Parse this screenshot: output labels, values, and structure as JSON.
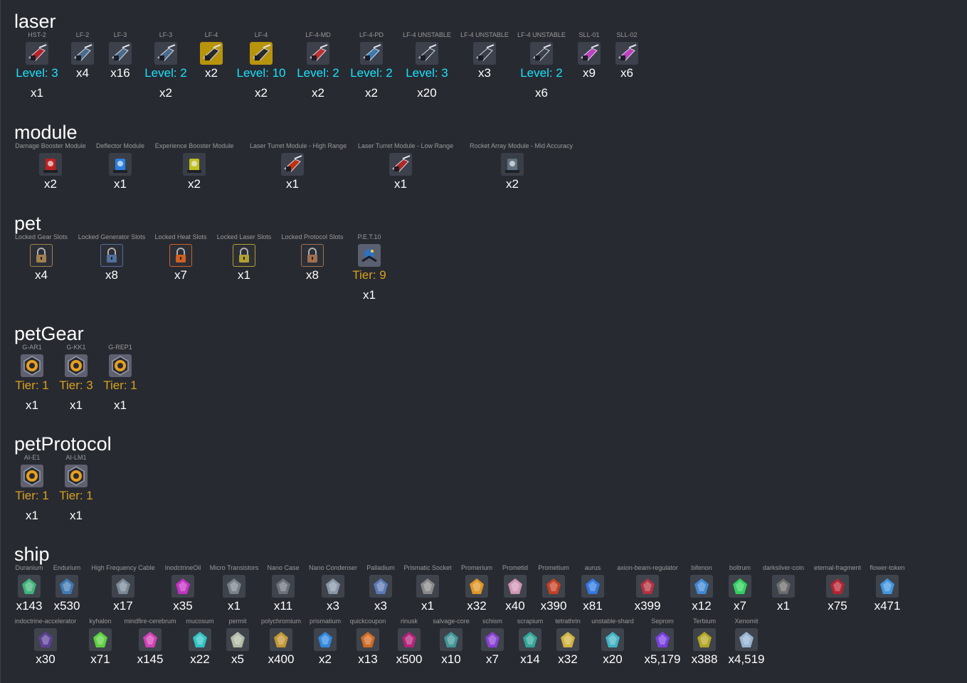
{
  "sections": [
    {
      "title": "laser",
      "items": [
        {
          "name": "HST-2",
          "stat": "Level: 3",
          "qty": "x1",
          "icon": "red-cannon-icon",
          "color": "#b8202a"
        },
        {
          "name": "LF-2",
          "qty": "x4",
          "icon": "laser-gun-icon",
          "color": "#4a6a8a"
        },
        {
          "name": "LF-3",
          "qty": "x16",
          "icon": "laser-gun-icon",
          "color": "#4a6a8a"
        },
        {
          "name": "LF-3",
          "stat": "Level: 2",
          "qty": "x2",
          "icon": "laser-gun-icon",
          "color": "#4a6a8a"
        },
        {
          "name": "LF-4",
          "qty": "x2",
          "icon": "gold-laser-icon",
          "color": "#c8a010"
        },
        {
          "name": "LF-4",
          "stat": "Level: 10",
          "qty": "x2",
          "icon": "gold-laser-icon",
          "color": "#c8a010"
        },
        {
          "name": "LF-4-MD",
          "stat": "Level: 2",
          "qty": "x2",
          "icon": "red-laser-icon",
          "color": "#c03030"
        },
        {
          "name": "LF-4-PD",
          "stat": "Level: 2",
          "qty": "x2",
          "icon": "blue-laser-icon",
          "color": "#3a7ab0"
        },
        {
          "name": "LF-4 UNSTABLE",
          "stat": "Level: 3",
          "qty": "x20",
          "icon": "dark-laser-icon",
          "color": "#3a3f48"
        },
        {
          "name": "LF-4 UNSTABLE",
          "qty": "x3",
          "icon": "dark-laser-icon",
          "color": "#3a3f48"
        },
        {
          "name": "LF-4 UNSTABLE",
          "stat": "Level: 2",
          "qty": "x6",
          "icon": "dark-laser-icon",
          "color": "#3a3f48"
        },
        {
          "name": "SLL-01",
          "qty": "x9",
          "icon": "pink-laser-icon",
          "color": "#c040c0"
        },
        {
          "name": "SLL-02",
          "qty": "x6",
          "icon": "pink-laser-icon",
          "color": "#c040c0"
        }
      ]
    },
    {
      "title": "module",
      "items": [
        {
          "name": "Damage Booster Module",
          "qty": "x2",
          "icon": "damage-module-icon",
          "color": "#c02020"
        },
        {
          "name": "Deflector Module",
          "qty": "x1",
          "icon": "deflector-module-icon",
          "color": "#2a80e0"
        },
        {
          "name": "Experience Booster Module",
          "qty": "x2",
          "icon": "experience-module-icon",
          "color": "#c0c020"
        },
        {
          "name": "Laser Turret Module - High Range",
          "qty": "x1",
          "icon": "laser-turret-module-icon",
          "color": "#c03010"
        },
        {
          "name": "Laser Turret Module - Low Range",
          "qty": "x1",
          "icon": "laser-turret-module-icon",
          "color": "#b02828"
        },
        {
          "name": "Rocket Array Module - Mid Accuracy",
          "qty": "x2",
          "icon": "rocket-array-module-icon",
          "color": "#607080"
        }
      ]
    },
    {
      "title": "pet",
      "items": [
        {
          "name": "Locked Gear Slots",
          "qty": "x4",
          "icon": "padlock-icon",
          "color": "#a08050"
        },
        {
          "name": "Locked Generator Slots",
          "qty": "x8",
          "icon": "padlock-icon",
          "color": "#5070a0"
        },
        {
          "name": "Locked Heat Slots",
          "qty": "x7",
          "icon": "padlock-icon",
          "color": "#d06020"
        },
        {
          "name": "Locked Laser Slots",
          "qty": "x1",
          "icon": "padlock-icon",
          "color": "#b0a030"
        },
        {
          "name": "Locked Protocol Slots",
          "qty": "x8",
          "icon": "padlock-icon",
          "color": "#a07050"
        },
        {
          "name": "P.E.T.10",
          "stat": "Tier: 9",
          "qty": "x1",
          "icon": "pet-drone-icon",
          "color": "#3070c0"
        }
      ]
    },
    {
      "title": "petGear",
      "items": [
        {
          "name": "G-AR1",
          "stat": "Tier: 1",
          "qty": "x1",
          "icon": "gear-hex-icon",
          "color": "#e8a020"
        },
        {
          "name": "G-KK1",
          "stat": "Tier: 3",
          "qty": "x1",
          "icon": "gear-sun-icon",
          "color": "#e8a020"
        },
        {
          "name": "G-REP1",
          "stat": "Tier: 1",
          "qty": "x1",
          "icon": "gear-wrench-icon",
          "color": "#e8a020"
        }
      ]
    },
    {
      "title": "petProtocol",
      "items": [
        {
          "name": "AI-E1",
          "stat": "Tier: 1",
          "qty": "x1",
          "icon": "protocol-arrows-icon",
          "color": "#e8a020"
        },
        {
          "name": "AI-LM1",
          "stat": "Tier: 1",
          "qty": "x1",
          "icon": "protocol-star-icon",
          "color": "#e8a020"
        }
      ]
    },
    {
      "title": "ship",
      "items": [
        {
          "name": "Duranium",
          "qty": "x143",
          "icon": "green-crystal-icon",
          "color": "#40c080"
        },
        {
          "name": "Endurium",
          "qty": "x530",
          "icon": "blue-orb-icon",
          "color": "#4080c0"
        },
        {
          "name": "High Frequency Cable",
          "qty": "x17",
          "icon": "cable-icon",
          "color": "#8090a0"
        },
        {
          "name": "InodctrineOil",
          "qty": "x35",
          "icon": "magenta-vial-icon",
          "color": "#d030d0"
        },
        {
          "name": "Micro Transistors",
          "qty": "x1",
          "icon": "transistor-icon",
          "color": "#808890"
        },
        {
          "name": "Nano Case",
          "qty": "x11",
          "icon": "nano-case-icon",
          "color": "#707880"
        },
        {
          "name": "Nano Condenser",
          "qty": "x3",
          "icon": "condenser-icon",
          "color": "#90a0b0"
        },
        {
          "name": "Palladium",
          "qty": "x3",
          "icon": "palladium-icon",
          "color": "#6080c0"
        },
        {
          "name": "Prismatic Socket",
          "qty": "x1",
          "icon": "socket-icon",
          "color": "#909090"
        },
        {
          "name": "Promerium",
          "qty": "x32",
          "icon": "orange-ore-icon",
          "color": "#f0a020"
        },
        {
          "name": "Prometid",
          "qty": "x40",
          "icon": "pink-crystal-icon",
          "color": "#e0a0c0"
        },
        {
          "name": "Prometium",
          "qty": "x390",
          "icon": "red-ore-icon",
          "color": "#d04020"
        },
        {
          "name": "aurus",
          "qty": "x81",
          "icon": "blue-shard-icon",
          "color": "#3080f0"
        },
        {
          "name": "axion-beam-regulator",
          "qty": "x399",
          "icon": "regulator-icon",
          "color": "#c03040"
        },
        {
          "name": "bifenon",
          "qty": "x12",
          "icon": "blue-diamond-icon",
          "color": "#4090e0"
        },
        {
          "name": "boltrum",
          "qty": "x7",
          "icon": "green-gem-icon",
          "color": "#30e060"
        },
        {
          "name": "darksilver-coin",
          "qty": "x1",
          "icon": "coin-icon",
          "color": "#707070"
        },
        {
          "name": "eternal-fragment",
          "qty": "x75",
          "icon": "fragment-icon",
          "color": "#c02030"
        },
        {
          "name": "flower-token",
          "qty": "x471",
          "icon": "flower-icon",
          "color": "#40a0f0"
        },
        {
          "name": "indoctrine-accelerator",
          "qty": "x30",
          "icon": "accelerator-icon",
          "color": "#6040a0"
        },
        {
          "name": "kyhalon",
          "qty": "x71",
          "icon": "triangle-gem-icon",
          "color": "#60e040"
        },
        {
          "name": "mindfire-cerebrum",
          "qty": "x145",
          "icon": "cerebrum-icon",
          "color": "#e040c0"
        },
        {
          "name": "mucosum",
          "qty": "x22",
          "icon": "teal-blob-icon",
          "color": "#30d0d0"
        },
        {
          "name": "permit",
          "qty": "x5",
          "icon": "permit-card-icon",
          "color": "#c0c8b0"
        },
        {
          "name": "polychromium",
          "qty": "x400",
          "icon": "polychromium-icon",
          "color": "#d0a030"
        },
        {
          "name": "prismatium",
          "qty": "x2",
          "icon": "prism-crystal-icon",
          "color": "#3090f0"
        },
        {
          "name": "quickcoupon",
          "qty": "x13",
          "icon": "coupon-icon",
          "color": "#e07020"
        },
        {
          "name": "rinusk",
          "qty": "x500",
          "icon": "rinusk-icon",
          "color": "#c02080"
        },
        {
          "name": "salvage-core",
          "qty": "x10",
          "icon": "pyramid-icon",
          "color": "#40a0a0"
        },
        {
          "name": "schism",
          "qty": "x7",
          "icon": "purple-shard-icon",
          "color": "#9040e0"
        },
        {
          "name": "scrapium",
          "qty": "x14",
          "icon": "scrapium-icon",
          "color": "#30b0a0"
        },
        {
          "name": "tetrathrin",
          "qty": "x32",
          "icon": "lightning-icon",
          "color": "#e0c040"
        },
        {
          "name": "unstable-shard",
          "qty": "x20",
          "icon": "shard-cube-icon",
          "color": "#40c0d0"
        },
        {
          "name": "Seprom",
          "qty": "x5,179",
          "icon": "purple-orb-icon",
          "color": "#8040f0"
        },
        {
          "name": "Terbium",
          "qty": "x388",
          "icon": "terbium-icon",
          "color": "#c0b020"
        },
        {
          "name": "Xenomit",
          "qty": "x4,519",
          "icon": "xenomit-icon",
          "color": "#a0c0e0"
        }
      ]
    }
  ]
}
